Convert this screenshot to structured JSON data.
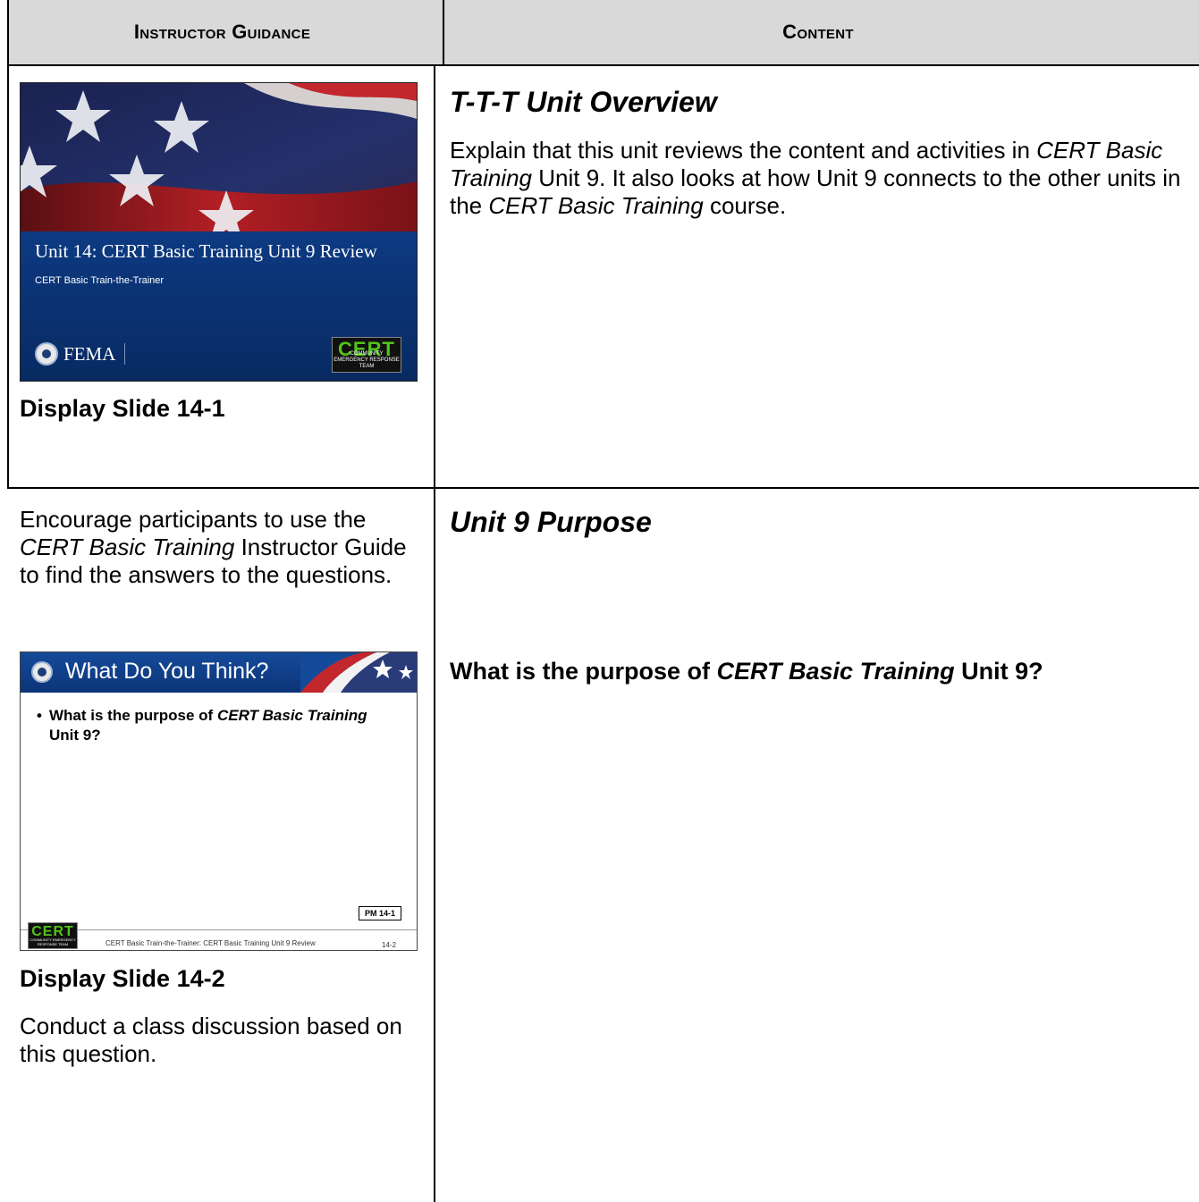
{
  "header": {
    "left": "Instructor Guidance",
    "right": "Content"
  },
  "row1": {
    "slide": {
      "title": "Unit 14: CERT Basic Training Unit 9 Review",
      "subtitle": "CERT Basic Train-the-Trainer",
      "agency": "FEMA",
      "logo": "CERT",
      "logo_subtext": "COMMUNITY EMERGENCY RESPONSE TEAM"
    },
    "caption": "Display Slide 14-1",
    "content_title": "T-T-T Unit Overview",
    "content_text": {
      "p1": "Explain that this unit reviews the content and activities in ",
      "p2": "CERT Basic Training",
      "p3": " Unit 9. It also looks at how Unit 9 connects to the other units in the ",
      "p4": "CERT Basic Training",
      "p5": " course."
    }
  },
  "row2": {
    "guidance_text": {
      "p1": "Encourage participants to use the ",
      "p2": "CERT Basic Training",
      "p3": " Instructor Guide to find the answers to the questions."
    },
    "slide": {
      "title": "What Do You Think?",
      "bullet": {
        "a": "What is the purpose of ",
        "b": "CERT Basic Training",
        "c": " Unit 9?"
      },
      "pm_tag": "PM 14-1",
      "footer": "CERT Basic Train-the-Trainer: CERT Basic Training Unit 9 Review",
      "page_number": "14-2",
      "logo": "CERT",
      "logo_subtext": "COMMUNITY EMERGENCY RESPONSE TEAM"
    },
    "caption": "Display Slide 14-2",
    "after_text": "Conduct a class discussion based on this question.",
    "content_title": "Unit 9 Purpose",
    "question": {
      "a": "What is the purpose of ",
      "b": "CERT Basic Training",
      "c": " Unit 9?"
    }
  }
}
